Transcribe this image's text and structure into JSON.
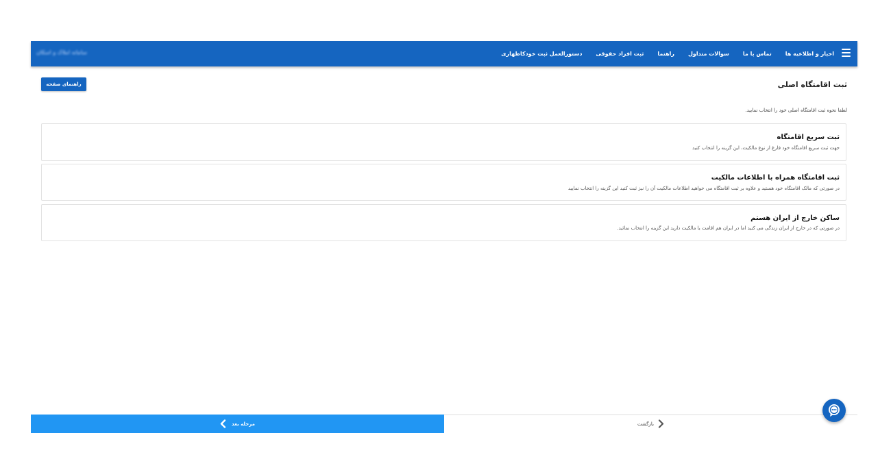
{
  "header": {
    "brand": "سامانه املاک و اسکان",
    "nav": [
      "اخبار و اطلاعیه ها",
      "تماس با ما",
      "سوالات متداول",
      "راهنما",
      "ثبت افراد حقوقی",
      "دستورالعمل ثبت خودکاظهاری"
    ]
  },
  "page": {
    "title": "ثبت اقامتگاه اصلی",
    "help_button": "راهنمای صفحه",
    "instruction": "لطفا نحوه ثبت اقامتگاه اصلی خود را انتخاب نمایید."
  },
  "options": [
    {
      "title": "ثبت سریع اقامتگاه",
      "description": "جهت ثبت سریع اقامتگاه خود فارغ از نوع مالکیت، این گزینه را انتخاب کنید"
    },
    {
      "title": "ثبت اقامتگاه همراه با اطلاعات مالکیت",
      "description": "در صورتی که مالک اقامتگاه خود هستید و علاوه بر ثبت اقامتگاه می خواهید اطلاعات مالکیت آن را نیز ثبت کنید این گزینه را انتخاب نمایید"
    },
    {
      "title": "ساکن خارج از ایران هستم",
      "description": "در صورتی که در خارج از ایران زندگی می کنید اما در ایران هم اقامت یا مالکیت دارید این گزینه را انتخاب نمائید."
    }
  ],
  "footer": {
    "next": "مرحله بعد",
    "back": "بازگشت"
  },
  "colors": {
    "primary": "#1565c0",
    "next_button": "#2196f3"
  },
  "icons": {
    "menu": "hamburger-menu-icon",
    "next": "chevron-left-icon",
    "back": "chevron-right-icon",
    "chat": "chat-bubble-icon"
  }
}
